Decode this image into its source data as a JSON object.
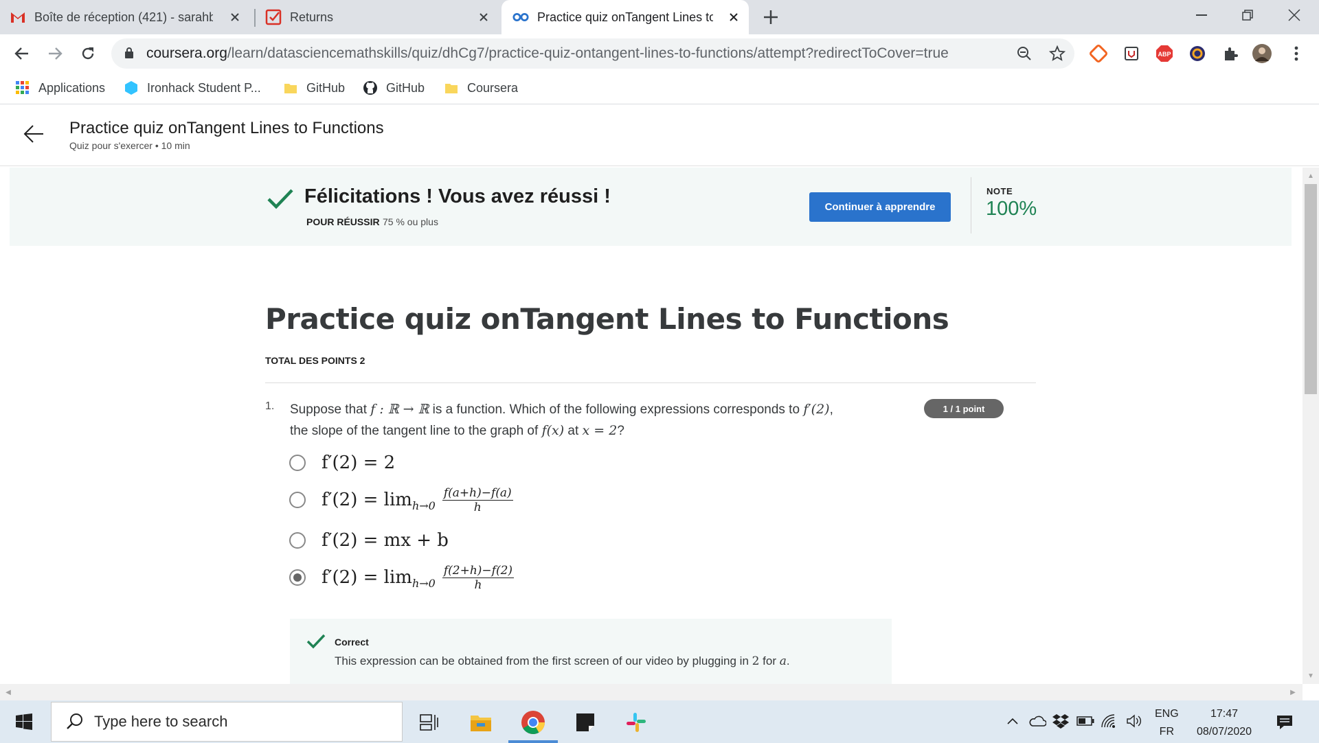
{
  "browser": {
    "tabs": [
      {
        "label": "Boîte de réception (421) - sarahb",
        "icon": "gmail-icon"
      },
      {
        "label": "Returns",
        "icon": "returns-icon"
      },
      {
        "label": "Practice quiz onTangent Lines to",
        "icon": "coursera-icon",
        "active": true
      }
    ],
    "url_host": "coursera.org",
    "url_path": "/learn/datasciencemathskills/quiz/dhCg7/practice-quiz-ontangent-lines-to-functions/attempt?redirectToCover=true",
    "bookmarks": [
      {
        "label": "Applications",
        "icon": "apps-grid-icon"
      },
      {
        "label": "Ironhack Student P...",
        "icon": "ironhack-icon"
      },
      {
        "label": "GitHub",
        "icon": "folder-icon"
      },
      {
        "label": "GitHub",
        "icon": "github-icon"
      },
      {
        "label": "Coursera",
        "icon": "folder-icon"
      }
    ],
    "extension_badges": {
      "abp": "ABP"
    }
  },
  "header": {
    "title": "Practice quiz onTangent Lines to Functions",
    "subtitle": "Quiz pour s'exercer • 10  min"
  },
  "result": {
    "congrats": "Félicitations ! Vous avez réussi !",
    "pass_label": "POUR RÉUSSIR",
    "pass_value": "75 % ou plus",
    "continue_label": "Continuer à apprendre",
    "note_label": "NOTE",
    "note_value": "100%",
    "accent_color": "#1f8354",
    "button_color": "#2a73cc"
  },
  "quiz": {
    "title": "Practice quiz onTangent Lines to Functions",
    "total_points": "TOTAL DES POINTS 2",
    "question": {
      "number": "1.",
      "text_parts": {
        "a": "Suppose that ",
        "b": "f : ℝ → ℝ",
        "c": " is a function. Which of the following expressions corresponds to ",
        "d": "f′(2)",
        "e": ",",
        "f": "the slope of the tangent line to the graph of ",
        "g": "f(x)",
        "h": " at ",
        "i": "x = 2",
        "j": "?"
      },
      "points": "1 / 1 point",
      "options": [
        {
          "lhs": "f′(2) = 2",
          "selected": false
        },
        {
          "lhs": "f′(2) = lim",
          "sub": "h→0",
          "num": "f(a+h)−f(a)",
          "den": "h",
          "selected": false
        },
        {
          "lhs": "f′(2) = mx + b",
          "selected": false
        },
        {
          "lhs": "f′(2) = lim",
          "sub": "h→0",
          "num": "f(2+h)−f(2)",
          "den": "h",
          "selected": true
        }
      ],
      "feedback": {
        "title": "Correct",
        "text_a": "This expression can be obtained from the first screen of our video by plugging in ",
        "text_b": "2",
        "text_c": " for ",
        "text_d": "a",
        "text_e": "."
      }
    }
  },
  "taskbar": {
    "search_placeholder": "Type here to search",
    "lang_top": "ENG",
    "lang_bottom": "FR",
    "time": "17:47",
    "date": "08/07/2020"
  }
}
